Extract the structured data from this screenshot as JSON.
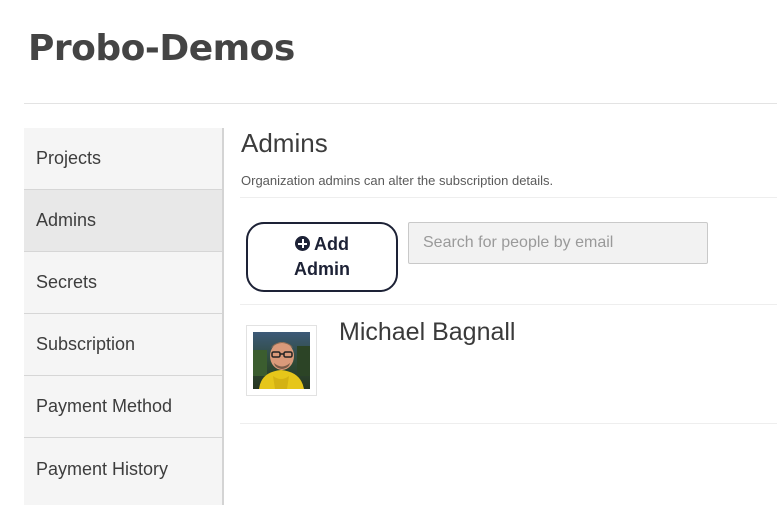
{
  "header": {
    "org_name": "Probo-Demos"
  },
  "sidebar": {
    "items": [
      {
        "label": "Projects",
        "active": false
      },
      {
        "label": "Admins",
        "active": true
      },
      {
        "label": "Secrets",
        "active": false
      },
      {
        "label": "Subscription",
        "active": false
      },
      {
        "label": "Payment Method",
        "active": false
      },
      {
        "label": "Payment History",
        "active": false
      }
    ]
  },
  "main": {
    "title": "Admins",
    "description": "Organization admins can alter the subscription details.",
    "add_button": {
      "label_line1": "Add",
      "label_line2": "Admin",
      "icon": "plus-circle-icon"
    },
    "search": {
      "placeholder": "Search for people by email",
      "value": ""
    },
    "admins": [
      {
        "name": "Michael Bagnall",
        "avatar": "user-photo"
      }
    ]
  },
  "colors": {
    "button_border": "#1d2236",
    "sidebar_bg": "#f5f5f5",
    "sidebar_active_bg": "#e8e8e8"
  }
}
